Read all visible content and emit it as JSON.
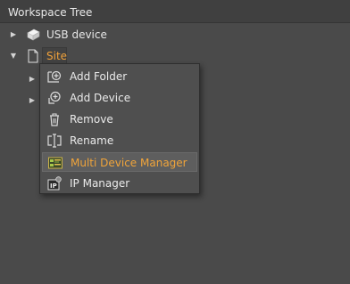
{
  "panel": {
    "title": "Workspace Tree"
  },
  "tree": {
    "items": [
      {
        "label": "USB device",
        "icon": "usb-device-icon",
        "expander": "collapsed"
      },
      {
        "label": "Site",
        "icon": "document-icon",
        "expander": "expanded",
        "selected": true
      }
    ]
  },
  "context_menu": {
    "items": [
      {
        "label": "Add Folder",
        "icon": "add-folder-icon"
      },
      {
        "label": "Add Device",
        "icon": "add-device-icon"
      },
      {
        "label": "Remove",
        "icon": "trash-icon"
      },
      {
        "label": "Rename",
        "icon": "rename-icon"
      },
      {
        "label": "Multi Device Manager",
        "icon": "multi-device-manager-icon",
        "highlighted": true
      },
      {
        "label": "IP Manager",
        "icon": "ip-manager-icon"
      }
    ]
  },
  "colors": {
    "background": "#4a4a4a",
    "accent": "#f2a23a",
    "text": "#e6e6e6"
  }
}
